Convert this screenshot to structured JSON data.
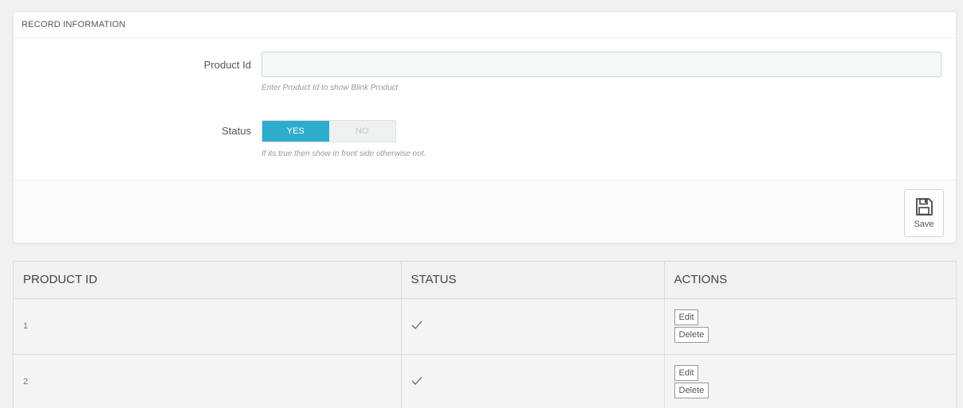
{
  "record_panel": {
    "heading": "RECORD INFORMATION",
    "product_id": {
      "label": "Product Id",
      "value": "",
      "help": "Enter Product Id to show Blink Product"
    },
    "status": {
      "label": "Status",
      "yes_label": "YES",
      "no_label": "NO",
      "selected": "YES",
      "help": "If its true then show in front side otherwise not."
    },
    "save_label": "Save",
    "accent_color": "#2eacce"
  },
  "table": {
    "columns": [
      "PRODUCT ID",
      "STATUS",
      "ACTIONS"
    ],
    "rows": [
      {
        "product_id": "1",
        "status": "check-icon",
        "edit_label": "Edit",
        "delete_label": "Delete"
      },
      {
        "product_id": "2",
        "status": "check-icon",
        "edit_label": "Edit",
        "delete_label": "Delete"
      }
    ]
  }
}
